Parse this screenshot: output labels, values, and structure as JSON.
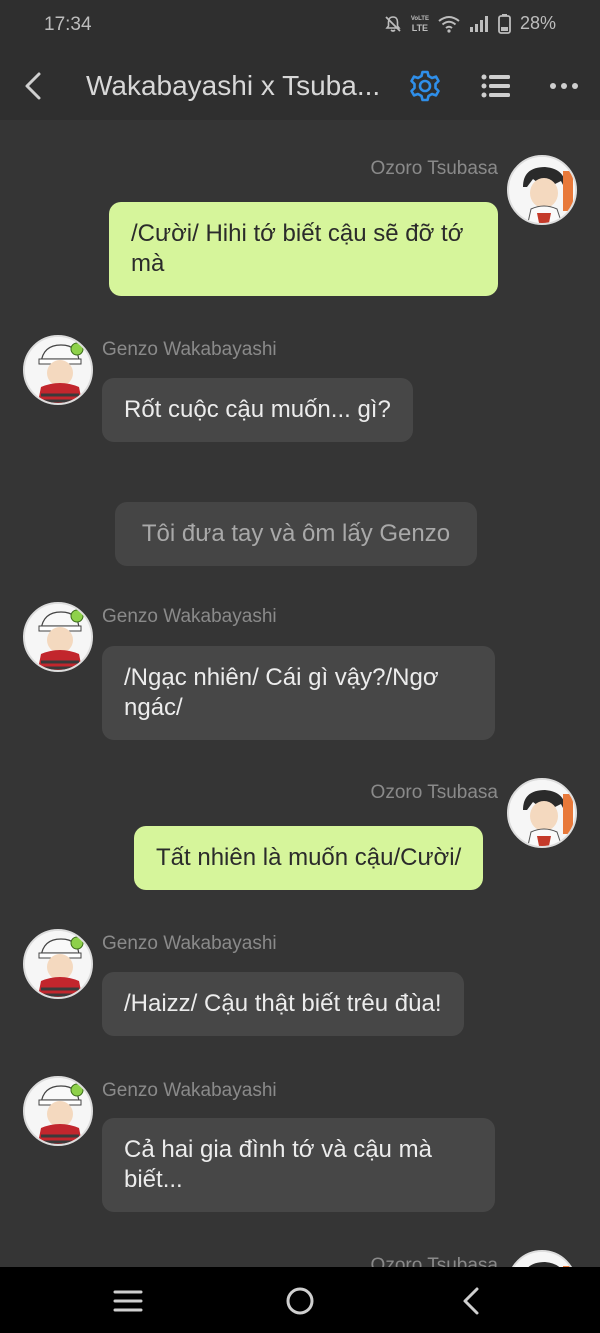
{
  "status_bar": {
    "time": "17:34",
    "lte_top": "VoLTE",
    "lte_bottom": "LTE",
    "battery": "28%"
  },
  "header": {
    "title": "Wakabayashi x Tsuba...",
    "accent_color": "#2f8fea"
  },
  "messages": [
    {
      "sender": "Ozoro Tsubasa",
      "text": "/Cười/ Hihi tớ biết cậu sẽ đỡ tớ mà",
      "side": "out"
    },
    {
      "sender": "Genzo Wakabayashi",
      "text": "Rốt cuộc cậu muốn... gì?",
      "side": "in"
    },
    {
      "sender": "",
      "text": "Tôi đưa tay và ôm lấy Genzo",
      "side": "narration"
    },
    {
      "sender": "Genzo Wakabayashi",
      "text": "/Ngạc nhiên/ Cái gì vậy?/Ngơ ngác/",
      "side": "in"
    },
    {
      "sender": "Ozoro Tsubasa",
      "text": "Tất nhiên là muốn cậu/Cười/",
      "side": "out"
    },
    {
      "sender": "Genzo Wakabayashi",
      "text": "/Haizz/ Cậu thật biết trêu đùa!",
      "side": "in"
    },
    {
      "sender": "Genzo Wakabayashi",
      "text": "Cả hai gia đình tớ và cậu mà biết...",
      "side": "in"
    },
    {
      "sender": "Ozoro Tsubasa",
      "text": "",
      "side": "out"
    }
  ],
  "colors": {
    "background": "#353535",
    "outgoing_bubble": "#d6f59b",
    "incoming_bubble": "#474747"
  }
}
